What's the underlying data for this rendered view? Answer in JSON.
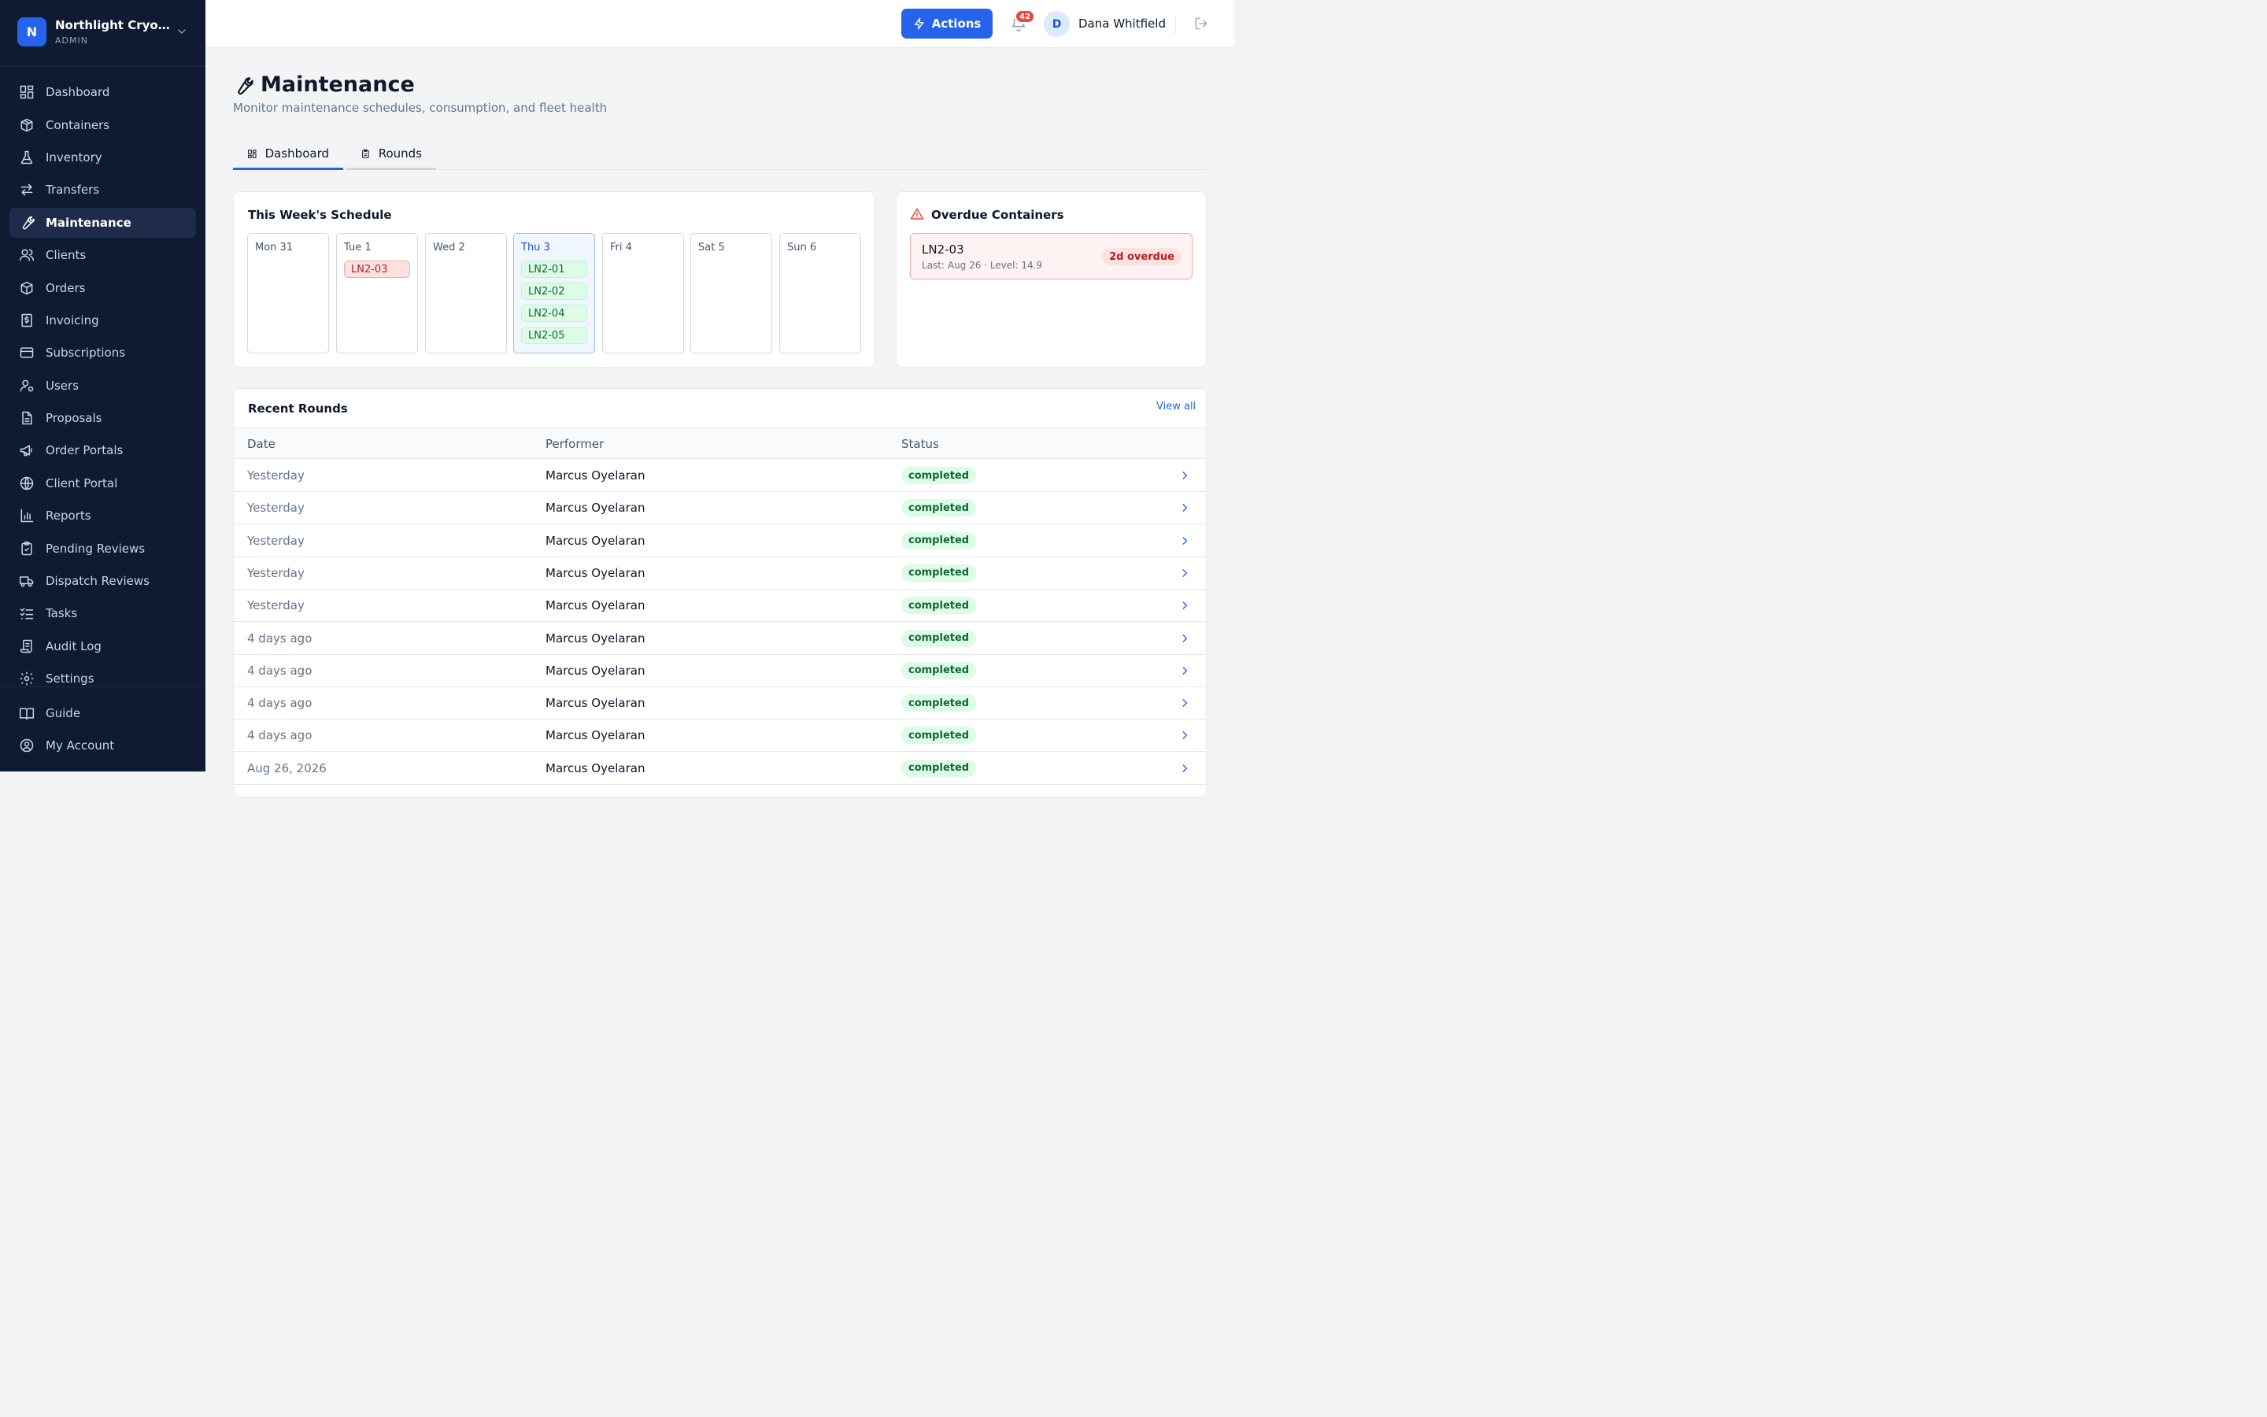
{
  "org": {
    "initial": "N",
    "name": "Northlight Cryoba...",
    "role": "ADMIN"
  },
  "nav": [
    {
      "label": "Dashboard",
      "icon": "dashboard-icon"
    },
    {
      "label": "Containers",
      "icon": "box-icon"
    },
    {
      "label": "Inventory",
      "icon": "flask-icon"
    },
    {
      "label": "Transfers",
      "icon": "transfer-icon"
    },
    {
      "label": "Maintenance",
      "icon": "wrench-icon",
      "active": true
    },
    {
      "label": "Clients",
      "icon": "users-icon"
    },
    {
      "label": "Orders",
      "icon": "package-icon"
    },
    {
      "label": "Invoicing",
      "icon": "dollar-receipt-icon"
    },
    {
      "label": "Subscriptions",
      "icon": "credit-card-icon"
    },
    {
      "label": "Users",
      "icon": "user-cog-icon"
    },
    {
      "label": "Proposals",
      "icon": "document-icon"
    },
    {
      "label": "Order Portals",
      "icon": "megaphone-icon"
    },
    {
      "label": "Client Portal",
      "icon": "globe-icon"
    },
    {
      "label": "Reports",
      "icon": "bar-chart-icon"
    },
    {
      "label": "Pending Reviews",
      "icon": "clipboard-check-icon"
    },
    {
      "label": "Dispatch Reviews",
      "icon": "truck-icon"
    },
    {
      "label": "Tasks",
      "icon": "list-checks-icon"
    },
    {
      "label": "Audit Log",
      "icon": "scroll-icon"
    },
    {
      "label": "Settings",
      "icon": "gear-icon"
    }
  ],
  "nav_bottom": [
    {
      "label": "Guide",
      "icon": "book-icon"
    },
    {
      "label": "My Account",
      "icon": "user-circle-icon"
    }
  ],
  "header": {
    "actions_label": "Actions",
    "notification_count": "42",
    "user_initial": "D",
    "user_name": "Dana Whitfield"
  },
  "page": {
    "title": "Maintenance",
    "subtitle": "Monitor maintenance schedules, consumption, and fleet health",
    "tabs": [
      {
        "label": "Dashboard",
        "active": true
      },
      {
        "label": "Rounds",
        "active": false
      }
    ]
  },
  "schedule": {
    "title": "This Week's Schedule",
    "days": [
      {
        "label": "Mon 31",
        "items": []
      },
      {
        "label": "Tue 1",
        "items": [
          {
            "name": "LN2-03",
            "status": "overdue"
          }
        ]
      },
      {
        "label": "Wed 2",
        "items": []
      },
      {
        "label": "Thu 3",
        "today": true,
        "items": [
          {
            "name": "LN2-01",
            "status": "scheduled"
          },
          {
            "name": "LN2-02",
            "status": "scheduled"
          },
          {
            "name": "LN2-04",
            "status": "scheduled"
          },
          {
            "name": "LN2-05",
            "status": "scheduled"
          }
        ]
      },
      {
        "label": "Fri 4",
        "items": []
      },
      {
        "label": "Sat 5",
        "items": []
      },
      {
        "label": "Sun 6",
        "items": []
      }
    ]
  },
  "overdue": {
    "title": "Overdue Containers",
    "items": [
      {
        "name": "LN2-03",
        "meta": "Last: Aug 26 · Level: 14.9",
        "badge": "2d overdue"
      }
    ]
  },
  "rounds": {
    "title": "Recent Rounds",
    "view_all": "View all",
    "columns": [
      "Date",
      "Performer",
      "Status"
    ],
    "rows": [
      {
        "date": "Yesterday",
        "performer": "Marcus Oyelaran",
        "status": "completed"
      },
      {
        "date": "Yesterday",
        "performer": "Marcus Oyelaran",
        "status": "completed"
      },
      {
        "date": "Yesterday",
        "performer": "Marcus Oyelaran",
        "status": "completed"
      },
      {
        "date": "Yesterday",
        "performer": "Marcus Oyelaran",
        "status": "completed"
      },
      {
        "date": "Yesterday",
        "performer": "Marcus Oyelaran",
        "status": "completed"
      },
      {
        "date": "4 days ago",
        "performer": "Marcus Oyelaran",
        "status": "completed"
      },
      {
        "date": "4 days ago",
        "performer": "Marcus Oyelaran",
        "status": "completed"
      },
      {
        "date": "4 days ago",
        "performer": "Marcus Oyelaran",
        "status": "completed"
      },
      {
        "date": "4 days ago",
        "performer": "Marcus Oyelaran",
        "status": "completed"
      },
      {
        "date": "Aug 26, 2026",
        "performer": "Marcus Oyelaran",
        "status": "completed"
      }
    ]
  },
  "colors": {
    "sidebar": "#0f1b33",
    "accent": "#2563eb",
    "danger": "#ef4444",
    "success": "#166534"
  }
}
